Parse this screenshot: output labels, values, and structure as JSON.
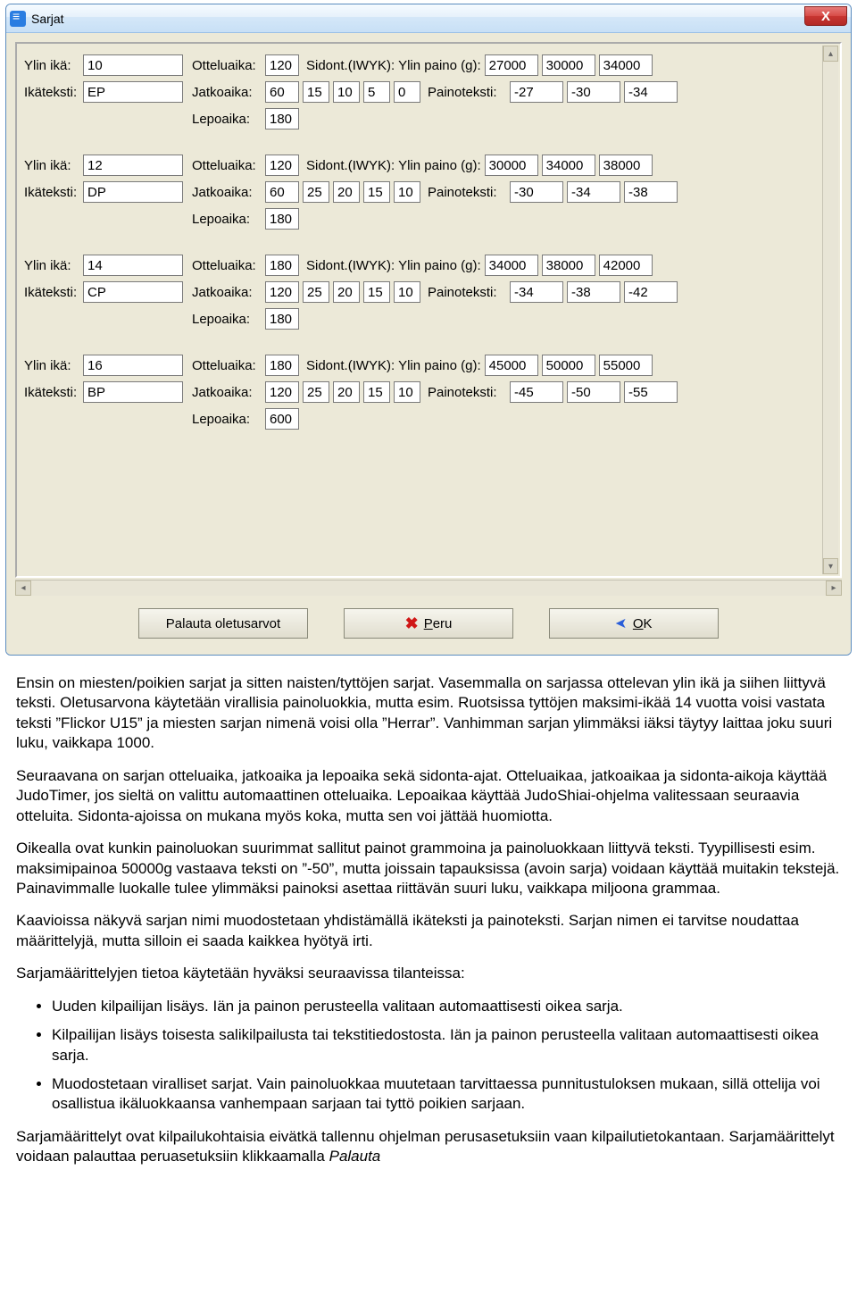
{
  "window": {
    "title": "Sarjat",
    "close": "X"
  },
  "labels": {
    "ylin_ika": "Ylin ikä:",
    "ikateksti": "Ikäteksti:",
    "otteluaika": "Otteluaika:",
    "jatkoaika": "Jatkoaika:",
    "lepoaika": "Lepoaika:",
    "sidont_paino": "Sidont.(IWYK): Ylin paino (g):",
    "painoteksti": "Painoteksti:"
  },
  "groups": [
    {
      "age": "10",
      "ageText": "EP",
      "matchTime": "120",
      "extraTime": [
        "60",
        "15",
        "10",
        "5",
        "0"
      ],
      "restTime": "180",
      "weights": [
        "27000",
        "30000",
        "34000"
      ],
      "weightTexts": [
        "-27",
        "-30",
        "-34"
      ]
    },
    {
      "age": "12",
      "ageText": "DP",
      "matchTime": "120",
      "extraTime": [
        "60",
        "25",
        "20",
        "15",
        "10"
      ],
      "restTime": "180",
      "weights": [
        "30000",
        "34000",
        "38000"
      ],
      "weightTexts": [
        "-30",
        "-34",
        "-38"
      ]
    },
    {
      "age": "14",
      "ageText": "CP",
      "matchTime": "180",
      "extraTime": [
        "120",
        "25",
        "20",
        "15",
        "10"
      ],
      "restTime": "180",
      "weights": [
        "34000",
        "38000",
        "42000"
      ],
      "weightTexts": [
        "-34",
        "-38",
        "-42"
      ]
    },
    {
      "age": "16",
      "ageText": "BP",
      "matchTime": "180",
      "extraTime": [
        "120",
        "25",
        "20",
        "15",
        "10"
      ],
      "restTime": "600",
      "weights": [
        "45000",
        "50000",
        "55000"
      ],
      "weightTexts": [
        "-45",
        "-50",
        "-55"
      ]
    }
  ],
  "buttons": {
    "restore": "Palauta oletusarvot",
    "cancel": "Peru",
    "ok": "OK"
  },
  "doc": {
    "p1": "Ensin on miesten/poikien sarjat ja sitten naisten/tyttöjen sarjat. Vasemmalla on sarjassa ottelevan ylin ikä ja siihen liittyvä teksti. Oletusarvona käytetään virallisia painoluokkia, mutta esim. Ruotsissa tyttöjen maksimi-ikää 14 vuotta voisi vastata teksti ”Flickor U15” ja miesten sarjan nimenä voisi olla ”Herrar”. Vanhimman sarjan ylimmäksi iäksi täytyy laittaa joku suuri luku, vaikkapa 1000.",
    "p2": "Seuraavana on sarjan otteluaika, jatkoaika ja lepoaika sekä sidonta-ajat. Otteluaikaa, jatkoaikaa ja sidonta-aikoja käyttää JudoTimer, jos sieltä on valittu automaattinen otteluaika. Lepoaikaa käyttää JudoShiai-ohjelma valitessaan seuraavia otteluita. Sidonta-ajoissa on mukana myös koka, mutta sen voi jättää huomiotta.",
    "p3": "Oikealla ovat kunkin painoluokan suurimmat sallitut painot grammoina ja painoluokkaan liittyvä teksti. Tyypillisesti esim. maksimipainoa 50000g vastaava teksti on ”-50”, mutta joissain tapauksissa (avoin sarja) voidaan käyttää muitakin tekstejä. Painavimmalle luokalle tulee ylimmäksi painoksi asettaa riittävän suuri luku, vaikkapa miljoona grammaa.",
    "p4": "Kaavioissa näkyvä sarjan nimi muodostetaan yhdistämällä ikäteksti ja painoteksti. Sarjan nimen ei tarvitse noudattaa määrittelyjä, mutta silloin ei saada kaikkea hyötyä irti.",
    "p5": "Sarjamäärittelyjen tietoa käytetään hyväksi seuraavissa tilanteissa:",
    "li1": "Uuden kilpailijan lisäys. Iän ja painon perusteella valitaan automaattisesti oikea sarja.",
    "li2": "Kilpailijan lisäys toisesta salikilpailusta tai tekstitiedostosta. Iän ja painon perusteella valitaan automaattisesti oikea sarja.",
    "li3": "Muodostetaan viralliset sarjat. Vain painoluokkaa muutetaan tarvittaessa punnitustuloksen mukaan, sillä ottelija voi osallistua ikäluokkaansa vanhempaan sarjaan tai tyttö poikien sarjaan.",
    "p6a": "Sarjamäärittelyt ovat kilpailukohtaisia eivätkä tallennu ohjelman perusasetuksiin vaan kilpailutietokantaan. Sarjamäärittelyt voidaan palauttaa peruasetuksiin klikkaamalla ",
    "p6b": "Palauta"
  }
}
